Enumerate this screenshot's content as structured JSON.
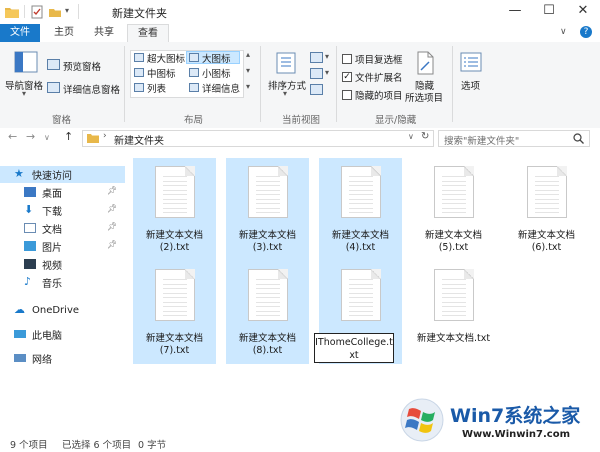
{
  "window": {
    "title": "新建文件夹",
    "controls": {
      "minimize": "—",
      "maximize": "☐",
      "close": "✕",
      "help": "?"
    }
  },
  "ribbon_tabs": [
    "文件",
    "主页",
    "共享",
    "查看"
  ],
  "ribbon": {
    "panes": {
      "label": "窗格",
      "nav_pane": "导航窗格",
      "preview_pane": "预览窗格",
      "details_pane": "详细信息窗格"
    },
    "layout": {
      "label": "布局",
      "items": [
        "超大图标",
        "大图标",
        "中图标",
        "小图标",
        "列表",
        "详细信息"
      ],
      "selected": "大图标"
    },
    "current_view": {
      "label": "当前视图",
      "sort_by": "排序方式"
    },
    "show_hide": {
      "label": "显示/隐藏",
      "item_checkboxes": "项目复选框",
      "file_extensions": "文件扩展名",
      "hidden_items": "隐藏的项目",
      "hide_selected": [
        "隐藏",
        "所选项目"
      ]
    },
    "options": "选项"
  },
  "address": {
    "path": "新建文件夹",
    "search_placeholder": "搜索\"新建文件夹\""
  },
  "nav_pane": {
    "quick_access": "快速访问",
    "items": [
      "桌面",
      "下载",
      "文档",
      "图片",
      "视频",
      "音乐"
    ],
    "onedrive": "OneDrive",
    "this_pc": "此电脑",
    "network": "网络"
  },
  "files": [
    {
      "name": "新建文本文档 (2).txt",
      "selected": true
    },
    {
      "name": "新建文本文档 (3).txt",
      "selected": true
    },
    {
      "name": "新建文本文档 (4).txt",
      "selected": true
    },
    {
      "name": "新建文本文档 (5).txt",
      "selected": false
    },
    {
      "name": "新建文本文档 (6).txt",
      "selected": false
    },
    {
      "name": "新建文本文档 (7).txt",
      "selected": true
    },
    {
      "name": "新建文本文档 (8).txt",
      "selected": true
    },
    {
      "name": "IThomeCollege.txt",
      "selected": true,
      "renaming": true
    },
    {
      "name": "新建文本文档.txt",
      "selected": false
    }
  ],
  "file_labels": {
    "f0": [
      "新建文本文档",
      "(2).txt"
    ],
    "f1": [
      "新建文本文档",
      "(3).txt"
    ],
    "f2": [
      "新建文本文档",
      "(4).txt"
    ],
    "f3": [
      "新建文本文档",
      "(5).txt"
    ],
    "f4": [
      "新建文本文档",
      "(6).txt"
    ],
    "f5": [
      "新建文本文档",
      "(7).txt"
    ],
    "f6": [
      "新建文本文档",
      "(8).txt"
    ],
    "f7": [
      "IThomeCollege.t",
      "xt"
    ],
    "f8": [
      "新建文本文档.txt"
    ]
  },
  "status": {
    "count": "9 个项目",
    "selected": "已选择 6 个项目",
    "size": "0 字节"
  },
  "watermark": {
    "brand_1": "Win7",
    "brand_2": "系统之家",
    "url": "Www.Winwin7.com"
  },
  "colors": {
    "accent": "#1979ca",
    "selection": "#cce8ff",
    "ribbon_bg": "#f5f6f7",
    "folder": "#e8b84a"
  }
}
